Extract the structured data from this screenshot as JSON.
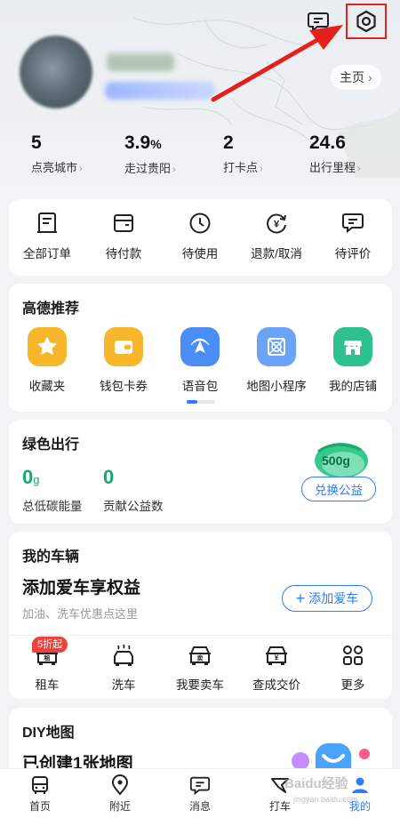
{
  "header": {
    "homepage_label": "主页",
    "homepage_chevron": "›",
    "message_icon": "message-icon",
    "settings_icon": "settings-gear-icon"
  },
  "stats": [
    {
      "value": "5",
      "unit": "",
      "label": "点亮城市"
    },
    {
      "value": "3.9",
      "unit": "%",
      "label": "走过贵阳"
    },
    {
      "value": "2",
      "unit": "",
      "label": "打卡点"
    },
    {
      "value": "24.6",
      "unit": "",
      "label": "出行里程"
    }
  ],
  "orders": [
    {
      "label": "全部订单",
      "icon": "order-list-icon"
    },
    {
      "label": "待付款",
      "icon": "wallet-card-icon"
    },
    {
      "label": "待使用",
      "icon": "clock-icon"
    },
    {
      "label": "退款/取消",
      "icon": "refund-yen-icon"
    },
    {
      "label": "待评价",
      "icon": "comment-icon"
    }
  ],
  "recommend": {
    "title": "高德推荐",
    "items": [
      {
        "label": "收藏夹",
        "icon": "star-icon",
        "color": "#f8b62d"
      },
      {
        "label": "钱包卡券",
        "icon": "wallet-icon",
        "color": "#f8b62d"
      },
      {
        "label": "语音包",
        "icon": "voice-navigation-icon",
        "color": "#4a8ef5"
      },
      {
        "label": "地图小程序",
        "icon": "mini-program-icon",
        "color": "#6aa3f7"
      },
      {
        "label": "我的店铺",
        "icon": "shop-icon",
        "color": "#2fc08f"
      }
    ]
  },
  "green": {
    "title": "绿色出行",
    "energy_value": "0",
    "energy_unit": "g",
    "energy_label": "总低碳能量",
    "charity_value": "0",
    "charity_label": "贡献公益数",
    "badge_value": "500g",
    "exchange_label": "兑换公益"
  },
  "vehicle": {
    "title": "我的车辆",
    "headline": "添加爱车享权益",
    "hint": "加油、洗车优惠点这里",
    "add_label": "添加爱车",
    "discount_badge": "5折起",
    "services": [
      {
        "label": "租车",
        "icon": "car-rental-icon"
      },
      {
        "label": "洗车",
        "icon": "car-wash-icon"
      },
      {
        "label": "我要卖车",
        "icon": "sell-car-icon",
        "glyph": "卖"
      },
      {
        "label": "查成交价",
        "icon": "car-price-icon",
        "glyph": "¥"
      },
      {
        "label": "更多",
        "icon": "grid-more-icon"
      }
    ]
  },
  "diy": {
    "title": "DIY地图",
    "headline": "已创建1张地图"
  },
  "tabbar": [
    {
      "label": "首页",
      "icon": "bus-home-icon",
      "active": false
    },
    {
      "label": "附近",
      "icon": "location-pin-icon",
      "active": false
    },
    {
      "label": "消息",
      "icon": "message-icon",
      "active": false
    },
    {
      "label": "打车",
      "icon": "taxi-flag-icon",
      "active": false
    },
    {
      "label": "我的",
      "icon": "profile-icon",
      "active": true
    }
  ],
  "watermark": {
    "main": "Baidu经验",
    "sub": "jingyan.baidu.com"
  },
  "colors": {
    "accent": "#2f7cf6",
    "green": "#16a779",
    "annotation_red": "#e3201b",
    "badge_red": "#f0403a"
  }
}
